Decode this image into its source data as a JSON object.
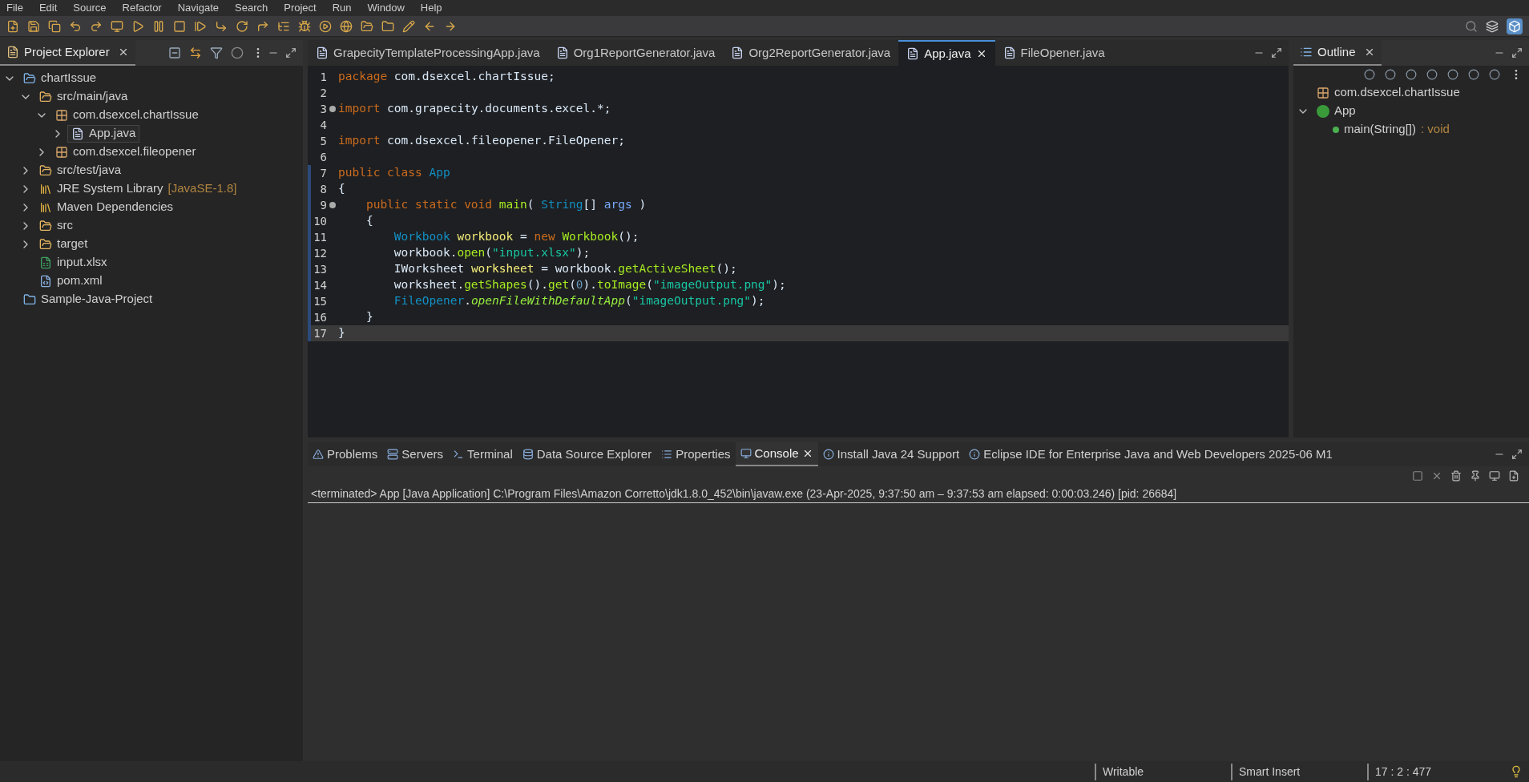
{
  "menu": [
    "File",
    "Edit",
    "Source",
    "Refactor",
    "Navigate",
    "Search",
    "Project",
    "Run",
    "Window",
    "Help"
  ],
  "explorer": {
    "title": "Project Explorer",
    "tree": [
      {
        "label": "chartIssue",
        "kind": "project",
        "expanded": true,
        "selected": false,
        "children": [
          {
            "label": "src/main/java",
            "kind": "source-folder",
            "expanded": true,
            "selected": false,
            "children": [
              {
                "label": "com.dsexcel.chartIssue",
                "kind": "package",
                "expanded": true,
                "selected": false,
                "children": [
                  {
                    "label": "App.java",
                    "kind": "java-file",
                    "expanded": false,
                    "selected": true
                  }
                ]
              },
              {
                "label": "com.dsexcel.fileopener",
                "kind": "package",
                "expanded": false,
                "selected": false
              }
            ]
          },
          {
            "label": "src/test/java",
            "kind": "source-folder",
            "expanded": false,
            "selected": false
          },
          {
            "label": "JRE System Library",
            "decoration": "[JavaSE-1.8]",
            "kind": "library",
            "expanded": false,
            "selected": false
          },
          {
            "label": "Maven Dependencies",
            "kind": "library",
            "expanded": false,
            "selected": false
          },
          {
            "label": "src",
            "kind": "folder",
            "expanded": false,
            "selected": false
          },
          {
            "label": "target",
            "kind": "folder",
            "expanded": false,
            "selected": false
          },
          {
            "label": "input.xlsx",
            "kind": "excel-file",
            "selected": false
          },
          {
            "label": "pom.xml",
            "kind": "xml-file",
            "selected": false
          }
        ]
      },
      {
        "label": "Sample-Java-Project",
        "kind": "closed-project",
        "selected": false
      }
    ]
  },
  "editor": {
    "tabs": [
      {
        "label": "GrapecityTemplateProcessingApp.java",
        "selected": false
      },
      {
        "label": "Org1ReportGenerator.java",
        "selected": false
      },
      {
        "label": "Org2ReportGenerator.java",
        "selected": false
      },
      {
        "label": "App.java",
        "selected": true
      },
      {
        "label": "FileOpener.java",
        "selected": false
      }
    ],
    "lines": [
      {
        "number": "1",
        "fold": false,
        "changed": false,
        "current": false,
        "tokens": [
          {
            "kind": "keyword",
            "text": "package"
          },
          {
            "kind": "plain",
            "text": " com.dsexcel.chartIssue;"
          }
        ]
      },
      {
        "number": "2",
        "fold": false,
        "changed": false,
        "current": false
      },
      {
        "number": "3",
        "fold": true,
        "changed": false,
        "current": false,
        "tokens": [
          {
            "kind": "keyword",
            "text": "import"
          },
          {
            "kind": "plain",
            "text": " com.grapecity.documents.excel.*;"
          }
        ]
      },
      {
        "number": "4",
        "fold": false,
        "changed": false,
        "current": false
      },
      {
        "number": "5",
        "fold": false,
        "changed": false,
        "current": false,
        "tokens": [
          {
            "kind": "keyword",
            "text": "import"
          },
          {
            "kind": "plain",
            "text": " com.dsexcel.fileopener.FileOpener;"
          }
        ]
      },
      {
        "number": "6",
        "fold": false,
        "changed": false,
        "current": false
      },
      {
        "number": "7",
        "fold": false,
        "changed": true,
        "current": false,
        "tokens": [
          {
            "kind": "keyword",
            "text": "public class "
          },
          {
            "kind": "type",
            "text": "App"
          }
        ]
      },
      {
        "number": "8",
        "fold": false,
        "changed": true,
        "current": false,
        "tokens": [
          {
            "kind": "plain",
            "text": "{"
          }
        ]
      },
      {
        "number": "9",
        "fold": true,
        "changed": true,
        "current": false,
        "tokens": [
          {
            "kind": "keyword",
            "text": "    public static void "
          },
          {
            "kind": "method",
            "text": "main"
          },
          {
            "kind": "plain",
            "text": "( "
          },
          {
            "kind": "type",
            "text": "String"
          },
          {
            "kind": "plain",
            "text": "[] "
          },
          {
            "kind": "param",
            "text": "args"
          },
          {
            "kind": "plain",
            "text": " )"
          }
        ]
      },
      {
        "number": "10",
        "fold": false,
        "changed": true,
        "current": false,
        "tokens": [
          {
            "kind": "plain",
            "text": "    {"
          }
        ]
      },
      {
        "number": "11",
        "fold": false,
        "changed": true,
        "current": false,
        "tokens": [
          {
            "kind": "type",
            "text": "        Workbook "
          },
          {
            "kind": "local",
            "text": "workbook"
          },
          {
            "kind": "plain",
            "text": " = "
          },
          {
            "kind": "keyword",
            "text": "new "
          },
          {
            "kind": "method",
            "text": "Workbook"
          },
          {
            "kind": "plain",
            "text": "();"
          }
        ]
      },
      {
        "number": "12",
        "fold": false,
        "changed": true,
        "current": false,
        "tokens": [
          {
            "kind": "plain",
            "text": "        workbook."
          },
          {
            "kind": "method",
            "text": "open"
          },
          {
            "kind": "plain",
            "text": "("
          },
          {
            "kind": "string",
            "text": "\"input.xlsx\""
          },
          {
            "kind": "plain",
            "text": ");"
          }
        ]
      },
      {
        "number": "13",
        "fold": false,
        "changed": true,
        "current": false,
        "tokens": [
          {
            "kind": "plain",
            "text": "        IWorksheet "
          },
          {
            "kind": "local",
            "text": "worksheet"
          },
          {
            "kind": "plain",
            "text": " = workbook."
          },
          {
            "kind": "method",
            "text": "getActiveSheet"
          },
          {
            "kind": "plain",
            "text": "();"
          }
        ]
      },
      {
        "number": "14",
        "fold": false,
        "changed": true,
        "current": false,
        "tokens": [
          {
            "kind": "plain",
            "text": "        worksheet."
          },
          {
            "kind": "method",
            "text": "getShapes"
          },
          {
            "kind": "plain",
            "text": "()."
          },
          {
            "kind": "method",
            "text": "get"
          },
          {
            "kind": "plain",
            "text": "("
          },
          {
            "kind": "number",
            "text": "0"
          },
          {
            "kind": "plain",
            "text": ")."
          },
          {
            "kind": "method",
            "text": "toImage"
          },
          {
            "kind": "plain",
            "text": "("
          },
          {
            "kind": "string",
            "text": "\"imageOutput.png\""
          },
          {
            "kind": "plain",
            "text": ");"
          }
        ]
      },
      {
        "number": "15",
        "fold": false,
        "changed": true,
        "current": false,
        "tokens": [
          {
            "kind": "type",
            "text": "        FileOpener"
          },
          {
            "kind": "plain",
            "text": "."
          },
          {
            "kind": "static-method",
            "text": "openFileWithDefaultApp"
          },
          {
            "kind": "plain",
            "text": "("
          },
          {
            "kind": "string",
            "text": "\"imageOutput.png\""
          },
          {
            "kind": "plain",
            "text": ");"
          }
        ]
      },
      {
        "number": "16",
        "fold": false,
        "changed": true,
        "current": false,
        "tokens": [
          {
            "kind": "plain",
            "text": "    }"
          }
        ]
      },
      {
        "number": "17",
        "fold": false,
        "changed": true,
        "current": true,
        "tokens": [
          {
            "kind": "plain",
            "text": "}"
          }
        ]
      }
    ]
  },
  "outline": {
    "title": "Outline",
    "items": [
      {
        "label": "com.dsexcel.chartIssue",
        "kind": "package",
        "selected": false
      },
      {
        "label": "App",
        "kind": "class",
        "expanded": true,
        "selected": false,
        "children": [
          {
            "label": "main(String[])",
            "suffix": " : void",
            "kind": "method",
            "selected": false
          }
        ]
      }
    ]
  },
  "bottom": {
    "tabs": [
      {
        "label": "Problems",
        "selected": false
      },
      {
        "label": "Servers",
        "selected": false
      },
      {
        "label": "Terminal",
        "selected": false
      },
      {
        "label": "Data Source Explorer",
        "selected": false
      },
      {
        "label": "Properties",
        "selected": false
      },
      {
        "label": "Console",
        "selected": true
      },
      {
        "label": "Install Java 24 Support",
        "selected": false
      },
      {
        "label": "Eclipse IDE for Enterprise Java and Web Developers 2025-06 M1",
        "selected": false
      }
    ],
    "console_header": "<terminated> App [Java Application] C:\\Program Files\\Amazon Corretto\\jdk1.8.0_452\\bin\\javaw.exe  (23-Apr-2025, 9:37:50 am – 9:37:53 am elapsed: 0:00:03.246) [pid: 26684]"
  },
  "status_bar": [
    "Writable",
    "Smart Insert",
    "17 : 2 : 477"
  ]
}
